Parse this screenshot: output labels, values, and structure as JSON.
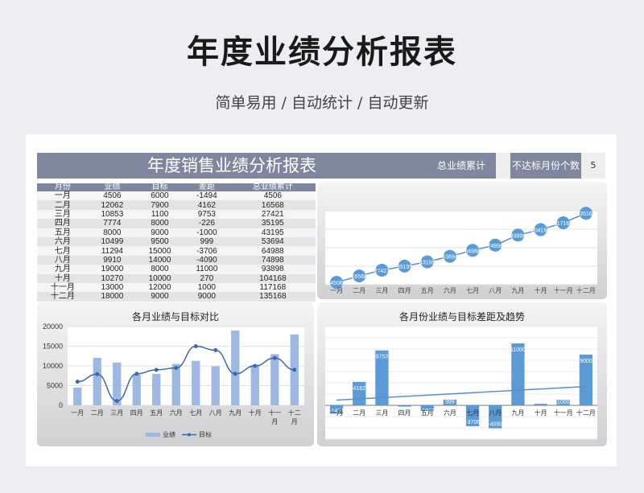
{
  "page": {
    "title": "年度业绩分析报表",
    "subtitle": "简单易用 / 自动统计 / 自动更新"
  },
  "header": {
    "title": "年度销售业绩分析报表",
    "total_label": "总业绩累计",
    "total_value": "",
    "missed_label": "不达标月份个数",
    "missed_value": "5"
  },
  "table": {
    "columns": [
      "月份",
      "业绩",
      "目标",
      "差距",
      "总业绩累计"
    ],
    "rows": [
      [
        "一月",
        "4506",
        "6000",
        "-1494",
        "4506"
      ],
      [
        "二月",
        "12062",
        "7900",
        "4162",
        "16568"
      ],
      [
        "三月",
        "10853",
        "1100",
        "9753",
        "27421"
      ],
      [
        "四月",
        "7774",
        "8000",
        "-226",
        "35195"
      ],
      [
        "五月",
        "8000",
        "9000",
        "-1000",
        "43195"
      ],
      [
        "六月",
        "10499",
        "9500",
        "999",
        "53694"
      ],
      [
        "七月",
        "11294",
        "15000",
        "-3706",
        "64988"
      ],
      [
        "八月",
        "9910",
        "14000",
        "-4090",
        "74898"
      ],
      [
        "九月",
        "19000",
        "8000",
        "11000",
        "93898"
      ],
      [
        "十月",
        "10270",
        "10000",
        "270",
        "104168"
      ],
      [
        "十一月",
        "13000",
        "12000",
        "1000",
        "117168"
      ],
      [
        "十二月",
        "18000",
        "9000",
        "9000",
        "135168"
      ]
    ]
  },
  "chart_data": [
    {
      "type": "line",
      "title": "",
      "categories": [
        "一月",
        "二月",
        "三月",
        "四月",
        "五月",
        "六月",
        "七月",
        "八月",
        "九月",
        "十月",
        "十一月",
        "十二月"
      ],
      "series": [
        {
          "values": [
            4506,
            16568,
            27421,
            35195,
            43195,
            53694,
            64988,
            74898,
            93898,
            104168,
            117168,
            135168
          ]
        }
      ],
      "point_labels": [
        "4506",
        "16568",
        "27421",
        "35195",
        "43195",
        "53694",
        "64988",
        "74898",
        "93898",
        "104168",
        "117168",
        "135168"
      ],
      "ylim": [
        0,
        140000
      ],
      "grid": true,
      "legend": "none",
      "colors": {
        "marker": "#5b9bd5",
        "line": "#5b8fc9"
      }
    },
    {
      "type": "bar",
      "title": "各月业绩与目标对比",
      "categories": [
        "一月",
        "二月",
        "三月",
        "四月",
        "五月",
        "六月",
        "七月",
        "八月",
        "九月",
        "十月",
        "十一月",
        "十二月"
      ],
      "series": [
        {
          "name": "业绩",
          "kind": "bar",
          "values": [
            4506,
            12062,
            10853,
            7774,
            8000,
            10499,
            11294,
            9910,
            19000,
            10270,
            13000,
            18000
          ]
        },
        {
          "name": "目标",
          "kind": "line",
          "values": [
            6000,
            7900,
            1100,
            8000,
            9000,
            9500,
            15000,
            14000,
            8000,
            10000,
            12000,
            9000
          ]
        }
      ],
      "yticks": [
        "0",
        "5000",
        "10000",
        "15000",
        "20000"
      ],
      "ylim": [
        0,
        20000
      ],
      "grid": true,
      "legend": "bottom",
      "colors": {
        "bar": "#9db9e3",
        "line": "#3c6aa8"
      }
    },
    {
      "type": "bar",
      "title": "各月份业绩与目标差距及趋势",
      "categories": [
        "一月",
        "二月",
        "三月",
        "四月",
        "五月",
        "六月",
        "七月",
        "八月",
        "九月",
        "十月",
        "十一月",
        "十二月"
      ],
      "series": [
        {
          "values": [
            -1494,
            4162,
            9753,
            -226,
            -1000,
            999,
            -3706,
            -4090,
            11000,
            270,
            1000,
            9000
          ]
        }
      ],
      "point_labels": [
        "-1494",
        "4162",
        "9753",
        "-226",
        "-1000",
        "999",
        "-3706",
        "-4090",
        "11000",
        "270",
        "1000",
        "9000"
      ],
      "trendline": "linear",
      "ylim": [
        -6000,
        14000
      ],
      "grid": true,
      "legend": "none",
      "colors": {
        "bar": "#5b9bd5",
        "trend": "#5b8fc9"
      }
    }
  ]
}
